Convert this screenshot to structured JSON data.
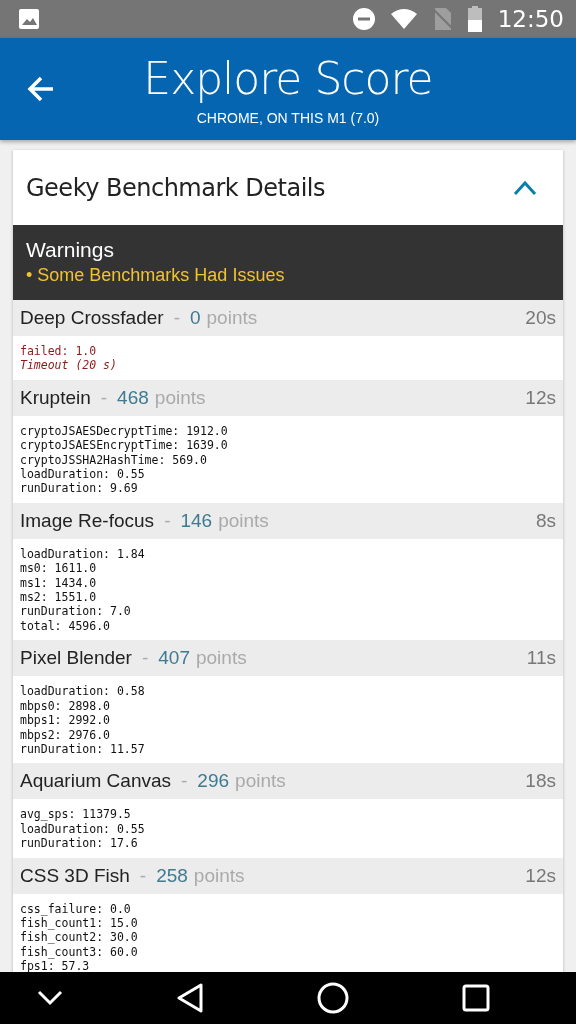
{
  "status_bar": {
    "time": "12:50"
  },
  "app_bar": {
    "title": "Explore Score",
    "subtitle": "CHROME, ON THIS M1 (7.0)"
  },
  "card": {
    "title": "Geeky Benchmark Details",
    "expanded": true,
    "warnings": {
      "title": "Warnings",
      "items": [
        "• Some Benchmarks Had Issues"
      ]
    },
    "benchmarks": [
      {
        "name": "Deep Crossfader",
        "separator": "-",
        "score": "0",
        "unit": "points",
        "time": "20s",
        "failed": true,
        "details": [
          "failed: 1.0"
        ],
        "note": "Timeout (20 s)"
      },
      {
        "name": "Kruptein",
        "separator": "-",
        "score": "468",
        "unit": "points",
        "time": "12s",
        "failed": false,
        "details": [
          "cryptoJSAESDecryptTime: 1912.0",
          "cryptoJSAESEncryptTime: 1639.0",
          "cryptoJSSHA2HashTime: 569.0",
          "loadDuration: 0.55",
          "runDuration: 9.69"
        ]
      },
      {
        "name": "Image Re-focus",
        "separator": "-",
        "score": "146",
        "unit": "points",
        "time": "8s",
        "failed": false,
        "details": [
          "loadDuration: 1.84",
          "ms0: 1611.0",
          "ms1: 1434.0",
          "ms2: 1551.0",
          "runDuration: 7.0",
          "total: 4596.0"
        ]
      },
      {
        "name": "Pixel Blender",
        "separator": "-",
        "score": "407",
        "unit": "points",
        "time": "11s",
        "failed": false,
        "details": [
          "loadDuration: 0.58",
          "mbps0: 2898.0",
          "mbps1: 2992.0",
          "mbps2: 2976.0",
          "runDuration: 11.57"
        ]
      },
      {
        "name": "Aquarium Canvas",
        "separator": "-",
        "score": "296",
        "unit": "points",
        "time": "18s",
        "failed": false,
        "details": [
          "avg_sps: 11379.5",
          "loadDuration: 0.55",
          "runDuration: 17.6"
        ]
      },
      {
        "name": "CSS 3D Fish",
        "separator": "-",
        "score": "258",
        "unit": "points",
        "time": "12s",
        "failed": false,
        "details": [
          "css_failure: 0.0",
          "fish_count1: 15.0",
          "fish_count2: 30.0",
          "fish_count3: 60.0",
          "fps1: 57.3"
        ]
      }
    ]
  }
}
